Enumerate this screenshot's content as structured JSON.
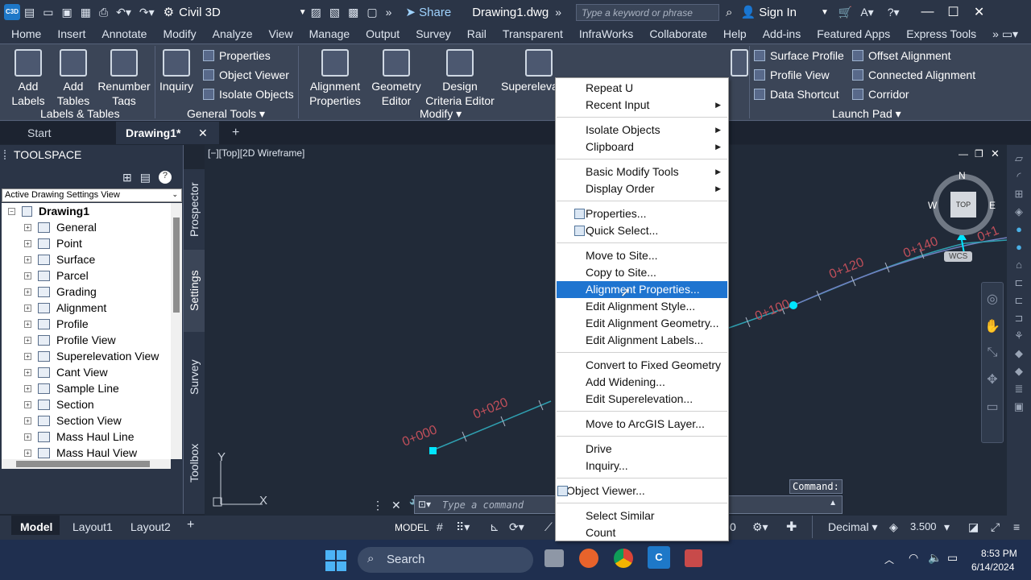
{
  "titlebar": {
    "app_badge": "C3D",
    "workspace": "Civil 3D",
    "share": "Share",
    "document": "Drawing1.dwg",
    "search_placeholder": "Type a keyword or phrase",
    "sign_in": "Sign In"
  },
  "ribbon_tabs": [
    "Home",
    "Insert",
    "Annotate",
    "Modify",
    "Analyze",
    "View",
    "Manage",
    "Output",
    "Survey",
    "Rail",
    "Transparent",
    "InfraWorks",
    "Collaborate",
    "Help",
    "Add-ins",
    "Featured Apps",
    "Express Tools"
  ],
  "ribbon": {
    "add_labels": "Add Labels",
    "add_tables": "Add Tables",
    "renumber_tags": "Renumber Tags",
    "labels_tables": "Labels & Tables",
    "inquiry": "Inquiry",
    "properties": "Properties",
    "object_viewer": "Object Viewer",
    "isolate_objects": "Isolate Objects",
    "general_tools": "General Tools",
    "alignment_properties": "Alignment Properties",
    "geometry_editor": "Geometry Editor",
    "design_criteria_editor": "Design Criteria Editor",
    "superelevation": "Superelevation",
    "modify": "Modify",
    "surface_profile": "Surface Profile",
    "profile_view": "Profile View",
    "data_shortcut": "Data Shortcut",
    "offset_alignment": "Offset Alignment",
    "connected_alignment": "Connected Alignment",
    "corridor": "Corridor",
    "launch_pad": "Launch Pad"
  },
  "doc_tabs": {
    "start": "Start",
    "active": "Drawing1*"
  },
  "toolspace": {
    "title": "TOOLSPACE",
    "view": "Active Drawing Settings View",
    "root": "Drawing1",
    "items": [
      "General",
      "Point",
      "Surface",
      "Parcel",
      "Grading",
      "Alignment",
      "Profile",
      "Profile View",
      "Superelevation View",
      "Cant View",
      "Sample Line",
      "Section",
      "Section View",
      "Mass Haul Line",
      "Mass Haul View"
    ],
    "vtabs": [
      "Prospector",
      "Settings",
      "Survey",
      "Toolbox"
    ]
  },
  "viewport": {
    "label": "[−][Top][2D Wireframe]",
    "stations": [
      "0+000",
      "0+020",
      "0+100",
      "0+120",
      "0+140",
      "0+1"
    ],
    "compass": {
      "n": "N",
      "w": "W",
      "e": "E",
      "top": "TOP",
      "wcs": "WCS"
    },
    "axis_x": "X",
    "axis_y": "Y",
    "command_label": "Command:"
  },
  "command_placeholder": "Type a command",
  "status": {
    "model": "Model",
    "layout1": "Layout1",
    "layout2": "Layout2",
    "model_btn": "MODEL",
    "units": "Decimal",
    "scale": "3.500",
    "zero": "0"
  },
  "context_menu": {
    "groups": [
      [
        "Repeat U",
        "Recent Input"
      ],
      [
        "Isolate Objects",
        "Clipboard"
      ],
      [
        "Basic Modify Tools",
        "Display Order"
      ],
      [
        "Properties...",
        "Quick Select..."
      ],
      [
        "Move to Site...",
        "Copy to Site...",
        "Alignment Properties...",
        "Edit Alignment Style...",
        "Edit Alignment Geometry...",
        "Edit Alignment Labels..."
      ],
      [
        "Convert to Fixed Geometry",
        "Add Widening...",
        "Edit Superelevation..."
      ],
      [
        "Move to ArcGIS Layer..."
      ],
      [
        "Drive",
        "Inquiry..."
      ],
      [
        "Object Viewer..."
      ],
      [
        "Select Similar",
        "Count"
      ]
    ],
    "highlighted": "Alignment Properties..."
  },
  "taskbar": {
    "search": "Search",
    "time": "8:53 PM",
    "date": "6/14/2024"
  }
}
